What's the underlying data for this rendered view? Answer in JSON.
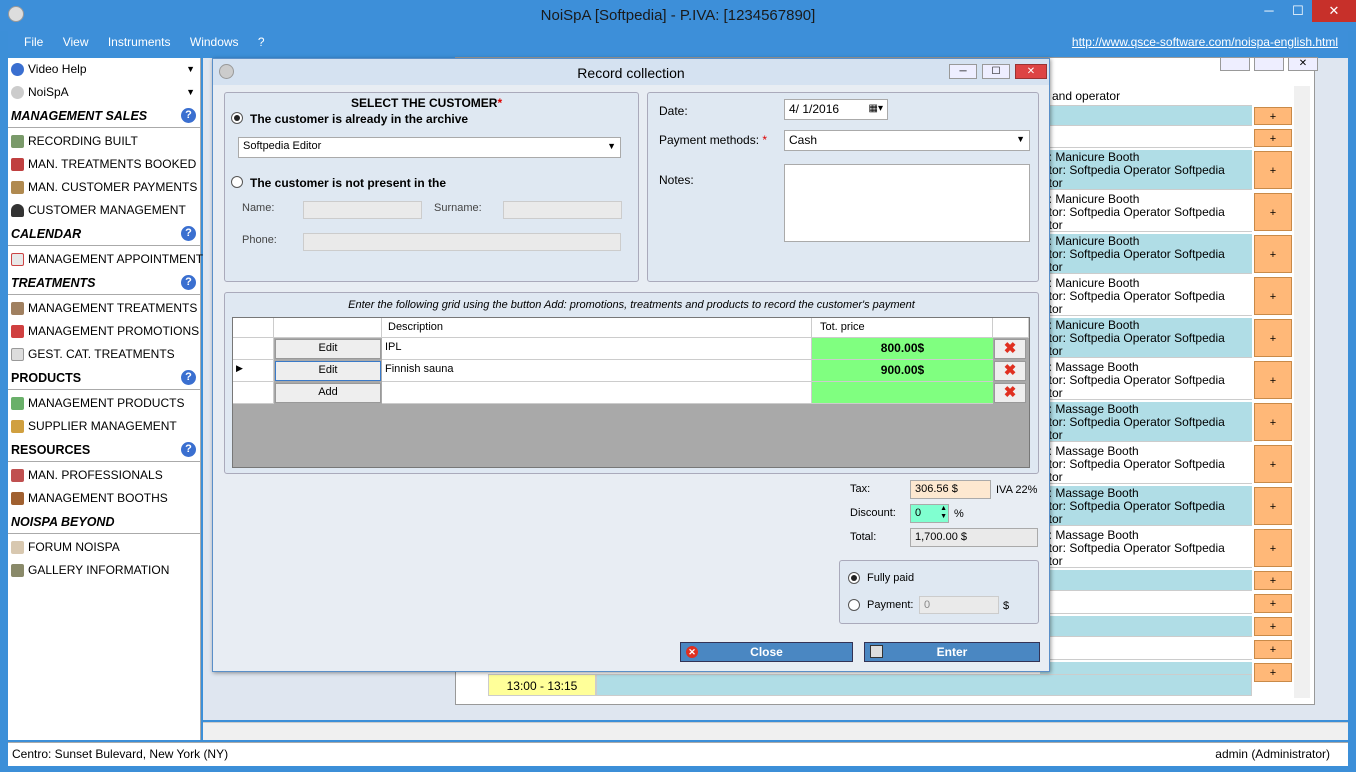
{
  "app": {
    "title": "NoiSpA  [Softpedia] - P.IVA: [1234567890]",
    "min": "─",
    "max": "☐",
    "close": "✕"
  },
  "menu": {
    "items": [
      "File",
      "View",
      "Instruments",
      "Windows",
      "?"
    ],
    "url": "http://www.qsce-software.com/noispa-english.html"
  },
  "sidebar": {
    "top": [
      {
        "label": "Video Help",
        "icon": "help-icon"
      },
      {
        "label": "NoiSpA",
        "icon": "app-icon"
      }
    ],
    "sections": [
      {
        "title": "MANAGEMENT SALES",
        "italic": true,
        "items": [
          "RECORDING BUILT",
          "MAN. TREATMENTS BOOKED",
          "MAN. CUSTOMER PAYMENTS",
          "CUSTOMER MANAGEMENT"
        ]
      },
      {
        "title": "CALENDAR",
        "italic": true,
        "items": [
          "MANAGEMENT APPOINTMENTS"
        ]
      },
      {
        "title": "TREATMENTS",
        "italic": true,
        "items": [
          "MANAGEMENT TREATMENTS",
          "MANAGEMENT PROMOTIONS",
          "GEST. CAT. TREATMENTS"
        ]
      },
      {
        "title": "PRODUCTS",
        "italic": false,
        "items": [
          "MANAGEMENT PRODUCTS",
          "SUPPLIER MANAGEMENT"
        ]
      },
      {
        "title": "RESOURCES",
        "italic": false,
        "items": [
          "MAN. PROFESSIONALS",
          "MANAGEMENT BOOTHS"
        ]
      },
      {
        "title": "NOISPA BEYOND",
        "italic": true,
        "items": [
          "FORUM NOISPA",
          "GALLERY INFORMATION"
        ]
      }
    ]
  },
  "background": {
    "header": "h and operator",
    "rows": [
      {
        "booth": "",
        "op": ""
      },
      {
        "booth": "",
        "op": ""
      },
      {
        "booth": "n: Manicure Booth",
        "op": "ator: Softpedia Operator Softpedia"
      },
      {
        "booth": "n: Manicure Booth",
        "op": "ator: Softpedia Operator Softpedia"
      },
      {
        "booth": "n: Manicure Booth",
        "op": "ator: Softpedia Operator Softpedia"
      },
      {
        "booth": "n: Manicure Booth",
        "op": "ator: Softpedia Operator Softpedia"
      },
      {
        "booth": "n: Manicure Booth",
        "op": "ator: Softpedia Operator Softpedia"
      },
      {
        "booth": "n: Massage Booth",
        "op": "ator: Softpedia Operator Softpedia"
      },
      {
        "booth": "n: Massage Booth",
        "op": "ator: Softpedia Operator Softpedia"
      },
      {
        "booth": "n: Massage Booth",
        "op": "ator: Softpedia Operator Softpedia"
      },
      {
        "booth": "n: Massage Booth",
        "op": "ator: Softpedia Operator Softpedia"
      },
      {
        "booth": "n: Massage Booth",
        "op": "ator: Softpedia Operator Softpedia"
      }
    ],
    "row_suffix": "ator",
    "time_slot": "13:00 - 13:15",
    "plus": "+"
  },
  "status": {
    "left": "Centro: Sunset Bulevard,  New York (NY)",
    "right": "admin (Administrator)"
  },
  "dialog": {
    "title": "Record collection",
    "customer": {
      "heading": "SELECT THE CUSTOMER",
      "required": "*",
      "opt_archive": "The customer is already in the archive",
      "selected_customer": "Softpedia Editor",
      "opt_new": "The customer is not present in the",
      "name_label": "Name:",
      "surname_label": "Surname:",
      "phone_label": "Phone:"
    },
    "payment": {
      "date_label": "Date:",
      "date_value": "4/  1/2016",
      "method_label": "Payment methods:",
      "required": "*",
      "method_value": "Cash",
      "notes_label": "Notes:"
    },
    "grid": {
      "caption": "Enter the following grid using the button Add: promotions, treatments and products to record the customer's payment",
      "col_description": "Description",
      "col_price": "Tot. price",
      "rows": [
        {
          "button": "Edit",
          "description": "IPL",
          "price": "800.00$"
        },
        {
          "button": "Edit",
          "description": "Finnish sauna",
          "price": "900.00$"
        },
        {
          "button": "Add",
          "description": "",
          "price": ""
        }
      ]
    },
    "totals": {
      "tax_label": "Tax:",
      "tax_value": "306.56 $",
      "tax_note": "IVA 22%",
      "discount_label": "Discount:",
      "discount_value": "0",
      "discount_unit": "%",
      "total_label": "Total:",
      "total_value": "1,700.00 $"
    },
    "paid": {
      "fully_paid": "Fully paid",
      "payment_label": "Payment:",
      "payment_value": "0",
      "payment_unit": "$"
    },
    "buttons": {
      "close": "Close",
      "enter": "Enter"
    }
  }
}
